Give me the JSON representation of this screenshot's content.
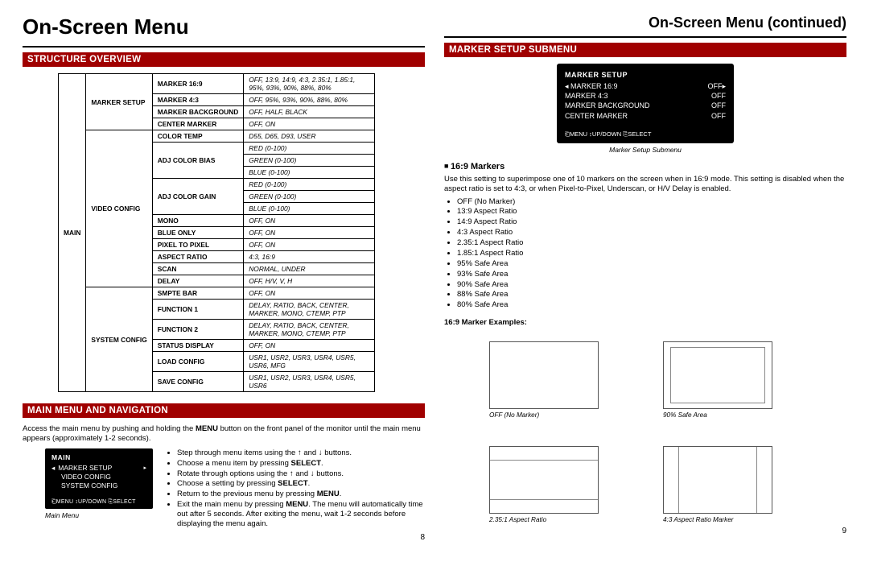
{
  "left": {
    "title": "On-Screen Menu",
    "section1": "STRUCTURE OVERVIEW",
    "table": {
      "main": "MAIN",
      "groups": [
        {
          "name": "MARKER SETUP",
          "rows": [
            {
              "k": "MARKER 16:9",
              "v": "OFF, 13:9, 14:9, 4:3, 2.35:1, 1.85:1, 95%, 93%, 90%, 88%, 80%"
            },
            {
              "k": "MARKER 4:3",
              "v": "OFF, 95%, 93%, 90%, 88%, 80%"
            },
            {
              "k": "MARKER BACKGROUND",
              "v": "OFF, HALF, BLACK"
            },
            {
              "k": "CENTER MARKER",
              "v": "OFF, ON"
            }
          ]
        },
        {
          "name": "VIDEO CONFIG",
          "rows": [
            {
              "k": "COLOR TEMP",
              "v": "D55, D65, D93, USER"
            },
            {
              "k": "ADJ COLOR BIAS",
              "v": "RED (0-100)\nGREEN (0-100)\nBLUE (0-100)"
            },
            {
              "k": "ADJ COLOR GAIN",
              "v": "RED (0-100)\nGREEN (0-100)\nBLUE (0-100)"
            },
            {
              "k": "MONO",
              "v": "OFF, ON"
            },
            {
              "k": "BLUE ONLY",
              "v": "OFF, ON"
            },
            {
              "k": "PIXEL TO PIXEL",
              "v": "OFF, ON"
            },
            {
              "k": "ASPECT RATIO",
              "v": "4:3, 16:9"
            },
            {
              "k": "SCAN",
              "v": "NORMAL, UNDER"
            },
            {
              "k": "DELAY",
              "v": "OFF, H/V, V, H"
            }
          ]
        },
        {
          "name": "SYSTEM CONFIG",
          "rows": [
            {
              "k": "SMPTE BAR",
              "v": "OFF, ON"
            },
            {
              "k": "FUNCTION 1",
              "v": "DELAY, RATIO, BACK, CENTER, MARKER, MONO, CTEMP, PTP"
            },
            {
              "k": "FUNCTION 2",
              "v": "DELAY, RATIO, BACK, CENTER, MARKER, MONO, CTEMP, PTP"
            },
            {
              "k": "STATUS DISPLAY",
              "v": "OFF, ON"
            },
            {
              "k": "LOAD CONFIG",
              "v": "USR1, USR2, USR3, USR4, USR5, USR6, MFG"
            },
            {
              "k": "SAVE CONFIG",
              "v": "USR1, USR2, USR3, USR4, USR5, USR6"
            }
          ]
        }
      ]
    },
    "section2": "MAIN MENU AND NAVIGATION",
    "navPara": "Access the main menu by pushing and holding the MENU button on the front panel of the monitor until the main menu appears (approximately 1-2 seconds).",
    "lcd": {
      "title": "MAIN",
      "items": [
        "MARKER SETUP",
        "VIDEO CONFIG",
        "SYSTEM CONFIG"
      ],
      "foot": "⎗MENU ↕UP/DOWN ⎘SELECT",
      "caption": "Main Menu"
    },
    "bullets": [
      "Step through menu items using the ↑ and ↓ buttons.",
      "Choose a menu item by pressing SELECT.",
      "Rotate through options using the ↑ and ↓ buttons.",
      "Choose a setting by pressing SELECT.",
      "Return to the previous menu by pressing MENU.",
      "Exit the main menu by pressing MENU. The menu will automatically time out after 5 seconds. After exiting the menu, wait 1-2 seconds before displaying the menu again."
    ],
    "pagenum": "8"
  },
  "right": {
    "title": "On-Screen Menu (continued)",
    "section1": "MARKER SETUP SUBMENU",
    "lcd": {
      "title": "MARKER SETUP",
      "rows": [
        {
          "k": "MARKER 16:9",
          "v": "OFF▸"
        },
        {
          "k": "MARKER 4:3",
          "v": "OFF"
        },
        {
          "k": "MARKER BACKGROUND",
          "v": "OFF"
        },
        {
          "k": "CENTER MARKER",
          "v": "OFF"
        }
      ],
      "foot": "⎗MENU ↕UP/DOWN ⎘SELECT",
      "caption": "Marker Setup Submenu"
    },
    "h169": "16:9 Markers",
    "h169para": "Use this setting to superimpose one of 10 markers on the screen when in 16:9 mode. This setting is disabled when the aspect ratio is set to 4:3, or when Pixel-to-Pixel, Underscan, or H/V Delay is enabled.",
    "markerList": [
      "OFF (No Marker)",
      "13:9 Aspect Ratio",
      "14:9 Aspect Ratio",
      "4:3 Aspect Ratio",
      "2.35:1 Aspect Ratio",
      "1.85:1 Aspect Ratio",
      "95% Safe Area",
      "93% Safe Area",
      "90% Safe Area",
      "88% Safe Area",
      "80% Safe Area"
    ],
    "exTitle": "16:9 Marker Examples:",
    "examples": [
      {
        "cap": "OFF (No Marker)",
        "type": "none"
      },
      {
        "cap": "90% Safe Area",
        "type": "inset"
      },
      {
        "cap": "2.35:1 Aspect Ratio",
        "type": "letterbox"
      },
      {
        "cap": "4:3 Aspect Ratio Marker",
        "type": "pillarbox"
      }
    ],
    "pagenum": "9"
  }
}
